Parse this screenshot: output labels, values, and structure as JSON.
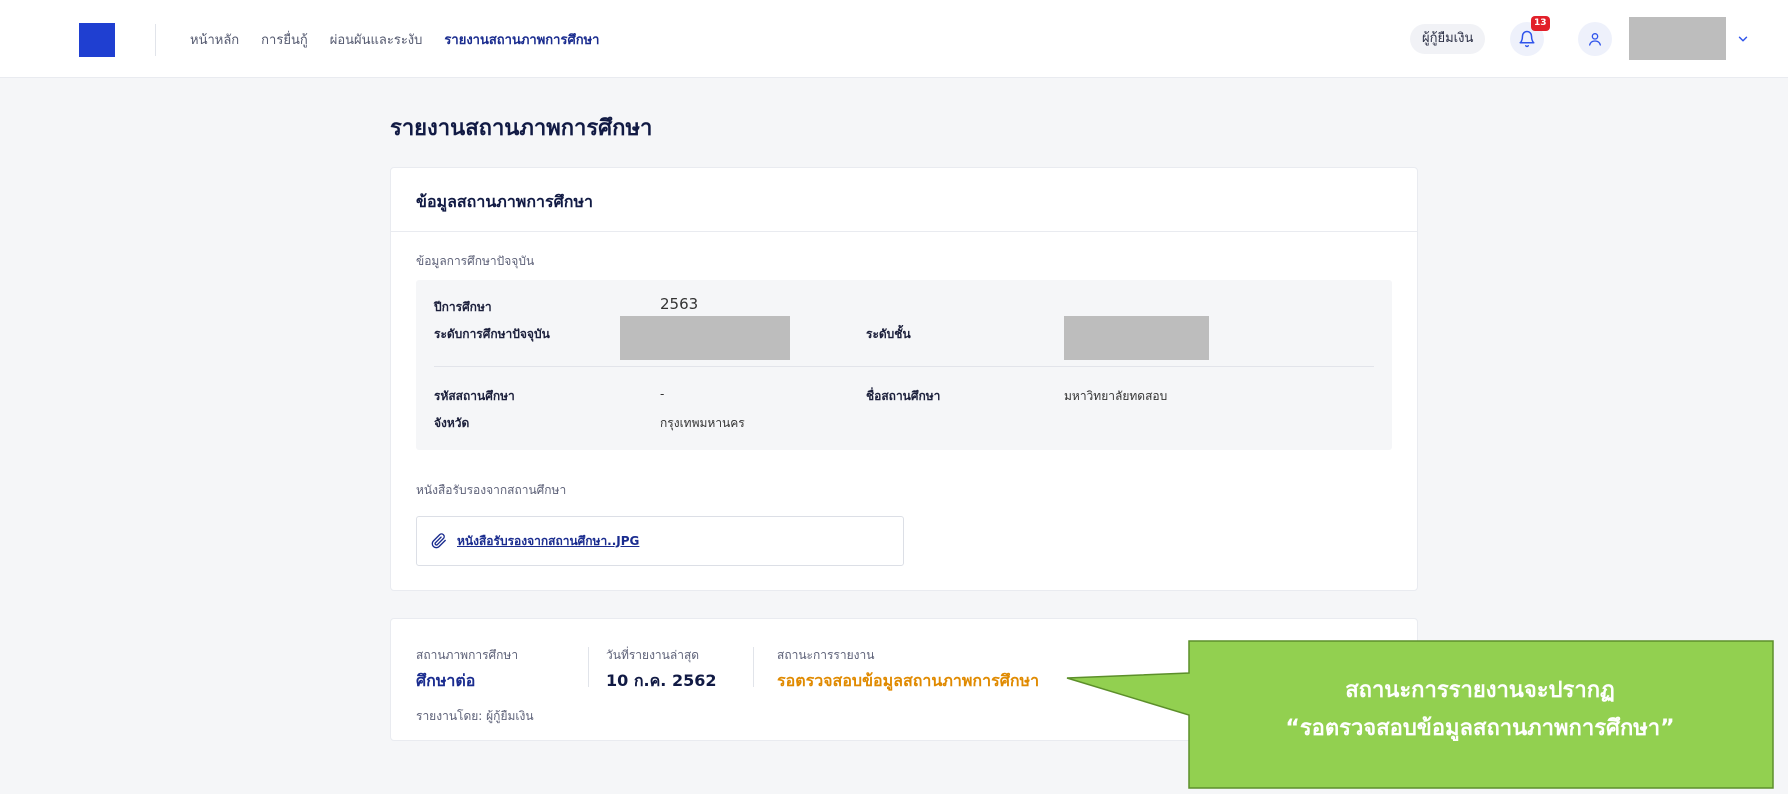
{
  "nav": {
    "items": [
      {
        "label": "หน้าหลัก",
        "active": false
      },
      {
        "label": "การยื่นกู้",
        "active": false
      },
      {
        "label": "ผ่อนผันและระงับ",
        "active": false
      },
      {
        "label": "รายงานสถานภาพการศึกษา",
        "active": true
      }
    ]
  },
  "header": {
    "role_label": "ผู้กู้ยืมเงิน",
    "notification_count": "13"
  },
  "page": {
    "title": "รายงานสถานภาพการศึกษา"
  },
  "education_card": {
    "title": "ข้อมูลสถานภาพการศึกษา",
    "current_section_label": "ข้อมูลการศึกษาปัจจุบัน",
    "fields": {
      "academic_year_label": "ปีการศึกษา",
      "academic_year_value": "2563",
      "current_level_label": "ระดับการศึกษาปัจจุบัน",
      "grade_label": "ระดับชั้น",
      "institution_code_label": "รหัสสถานศึกษา",
      "institution_code_value": "-",
      "institution_name_label": "ชื่อสถานศึกษา",
      "institution_name_value": "มหาวิทยาลัยทดสอบ",
      "province_label": "จังหวัด",
      "province_value": "กรุงเทพมหานคร"
    },
    "certificate_section_label": "หนังสือรับรองจากสถานศึกษา",
    "attachment_name": "หนังสือรับรองจากสถานศึกษา..JPG"
  },
  "status_card": {
    "education_status_label": "สถานภาพการศึกษา",
    "education_status_value": "ศึกษาต่อ",
    "reported_by": "รายงานโดย: ผู้กู้ยืมเงิน",
    "last_report_label": "วันที่รายงานล่าสุด",
    "last_report_value": "10 ก.ค. 2562",
    "report_status_label": "สถานะการรายงาน",
    "report_status_value": "รอตรวจสอบข้อมูลสถานภาพการศึกษา"
  },
  "callout": {
    "line1": "สถานะการรายงานจะปรากฏ",
    "line2": "“รอตรวจสอบข้อมูลสถานภาพการศึกษา”"
  },
  "colors": {
    "brand_blue": "#1f3fd1",
    "nav_active": "#1a2c8f",
    "status_orange": "#e08a00",
    "callout_green": "#92d050",
    "badge_red": "#e2202a"
  }
}
